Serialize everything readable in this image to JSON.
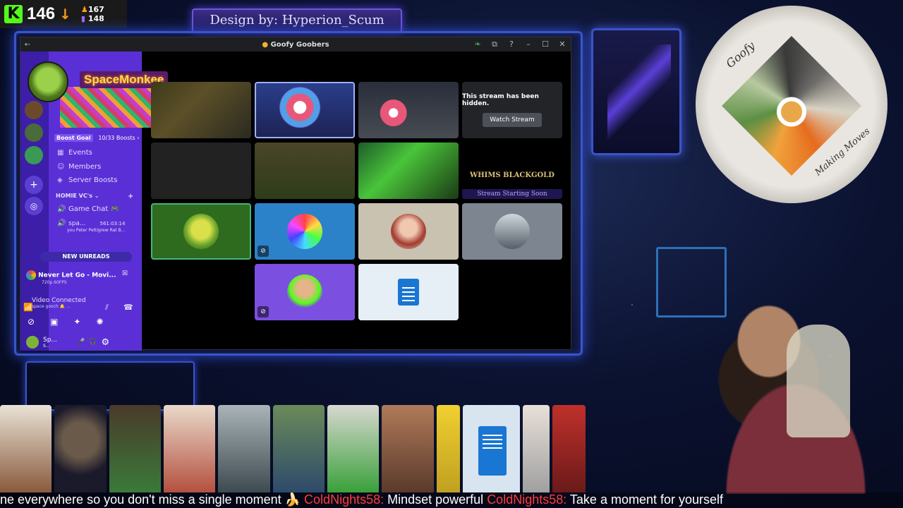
{
  "overlay": {
    "kick_logo": "K",
    "viewer_count": "146",
    "followers": "167",
    "subs": "148",
    "banner_text": "Design by: Hyperion_Scum"
  },
  "window": {
    "title": "Goofy Goobers",
    "controls": {
      "minimize": "–",
      "maximize": "☐",
      "close": "✕",
      "help": "?",
      "inbox": "⧉"
    }
  },
  "sidebar": {
    "user_title": "SpaceMonkee",
    "boost_goal": "Boost Goal",
    "boost_progress": "10/33 Boosts ›",
    "items": [
      {
        "label": "Events",
        "icon": "calendar-icon"
      },
      {
        "label": "Members",
        "icon": "members-icon"
      },
      {
        "label": "Server Boosts",
        "icon": "boost-icon"
      }
    ],
    "category": "HOMIE VC's ⌄",
    "channels": [
      {
        "label": "Game Chat 🎮",
        "icon": "speaker-icon"
      },
      {
        "label": "spa...",
        "timer": "561:03:14",
        "sub": "you Peter Pettigrew Rat B..."
      }
    ],
    "new_unreads": "NEW UNREADS",
    "now_playing": {
      "title": "Never Let Go - Movi...",
      "sub": "720p 60FPS"
    },
    "voice": {
      "status": "Video Connected",
      "sub": "space gooch 🔔 ..."
    },
    "user_panel": {
      "name": "Sp...",
      "status": "S..."
    }
  },
  "grid": {
    "hidden_message": "This stream has been hidden.",
    "watch_stream": "Watch Stream",
    "logo_caption": "Stream Starting Soon",
    "logo_name": "WHIMS BLACKGOLD"
  },
  "logo_disc": {
    "text_top": "Goofy",
    "text_bottom": "Making Moves"
  },
  "ticker": {
    "part1": "ne everywhere so you don't miss a single moment 🍌 ",
    "user1": "ColdNights58:",
    "part2": " Mindset powerful ",
    "user2": "ColdNights58:",
    "part3": " Take a moment for yourself"
  }
}
